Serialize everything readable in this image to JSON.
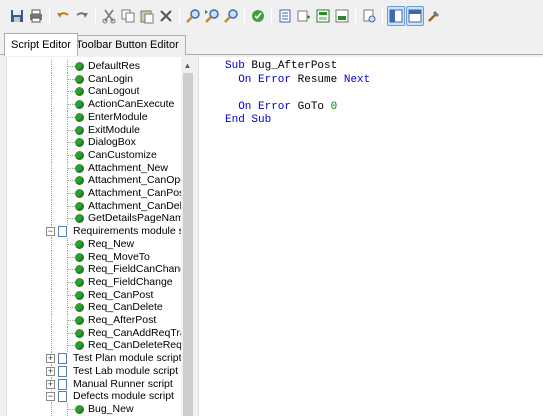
{
  "toolbar": {
    "buttons": [
      {
        "name": "save-icon"
      },
      {
        "name": "print-icon"
      },
      {
        "name": "undo-icon"
      },
      {
        "name": "redo-icon"
      },
      {
        "name": "cut-icon"
      },
      {
        "name": "copy-icon"
      },
      {
        "name": "paste-icon"
      },
      {
        "name": "delete-icon"
      },
      {
        "name": "find-icon"
      },
      {
        "name": "find-next-icon"
      },
      {
        "name": "replace-icon"
      },
      {
        "name": "syntax-check-icon"
      },
      {
        "name": "generate-script-icon"
      },
      {
        "name": "add-button-icon"
      },
      {
        "name": "toolbar-icon"
      },
      {
        "name": "copy-script-icon"
      },
      {
        "name": "view-script-icon"
      },
      {
        "name": "layout-tree-icon"
      },
      {
        "name": "layout-editor-icon"
      },
      {
        "name": "tools-icon"
      }
    ]
  },
  "tabs": {
    "script_editor": "Script Editor",
    "toolbar_button_editor": "Toolbar Button Editor"
  },
  "tree": {
    "rows": [
      {
        "label": "DefaultRes",
        "level": 2
      },
      {
        "label": "CanLogin",
        "level": 2
      },
      {
        "label": "CanLogout",
        "level": 2
      },
      {
        "label": "ActionCanExecute",
        "level": 2
      },
      {
        "label": "EnterModule",
        "level": 2
      },
      {
        "label": "ExitModule",
        "level": 2
      },
      {
        "label": "DialogBox",
        "level": 2
      },
      {
        "label": "CanCustomize",
        "level": 2
      },
      {
        "label": "Attachment_New",
        "level": 2
      },
      {
        "label": "Attachment_CanOpen",
        "level": 2
      },
      {
        "label": "Attachment_CanPost",
        "level": 2
      },
      {
        "label": "Attachment_CanDelete",
        "level": 2
      },
      {
        "label": "GetDetailsPageName",
        "level": 2
      },
      {
        "label": "Requirements module script",
        "level": 1,
        "expander": "−"
      },
      {
        "label": "Req_New",
        "level": 2
      },
      {
        "label": "Req_MoveTo",
        "level": 2
      },
      {
        "label": "Req_FieldCanChange",
        "level": 2
      },
      {
        "label": "Req_FieldChange",
        "level": 2
      },
      {
        "label": "Req_CanPost",
        "level": 2
      },
      {
        "label": "Req_CanDelete",
        "level": 2
      },
      {
        "label": "Req_AfterPost",
        "level": 2
      },
      {
        "label": "Req_CanAddReqTraces",
        "level": 2
      },
      {
        "label": "Req_CanDeleteReqTrace",
        "level": 2
      },
      {
        "label": "Test Plan module script",
        "level": 1,
        "expander": "+"
      },
      {
        "label": "Test Lab module script",
        "level": 1,
        "expander": "+"
      },
      {
        "label": "Manual Runner script",
        "level": 1,
        "expander": "+"
      },
      {
        "label": "Defects module script",
        "level": 1,
        "expander": "−"
      },
      {
        "label": "Bug_New",
        "level": 2
      }
    ]
  },
  "editor": {
    "lines": [
      [
        {
          "t": "Sub",
          "c": "kw"
        },
        {
          "t": " Bug_AfterPost",
          "c": ""
        }
      ],
      [
        {
          "t": "  ",
          "c": ""
        },
        {
          "t": "On Error",
          "c": "kw"
        },
        {
          "t": " ",
          "c": ""
        },
        {
          "t": "Resume",
          "c": ""
        },
        {
          "t": " ",
          "c": ""
        },
        {
          "t": "Next",
          "c": "kw"
        }
      ],
      [],
      [
        {
          "t": "  ",
          "c": ""
        },
        {
          "t": "On Error",
          "c": "kw"
        },
        {
          "t": " GoTo ",
          "c": ""
        },
        {
          "t": "0",
          "c": "num"
        }
      ],
      [
        {
          "t": "End Sub",
          "c": "kw"
        }
      ]
    ]
  },
  "colors": {
    "keyword": "#0000cc",
    "number": "#008000",
    "method_icon": "#2e9e2e",
    "script_icon": "#5a7fb5"
  }
}
